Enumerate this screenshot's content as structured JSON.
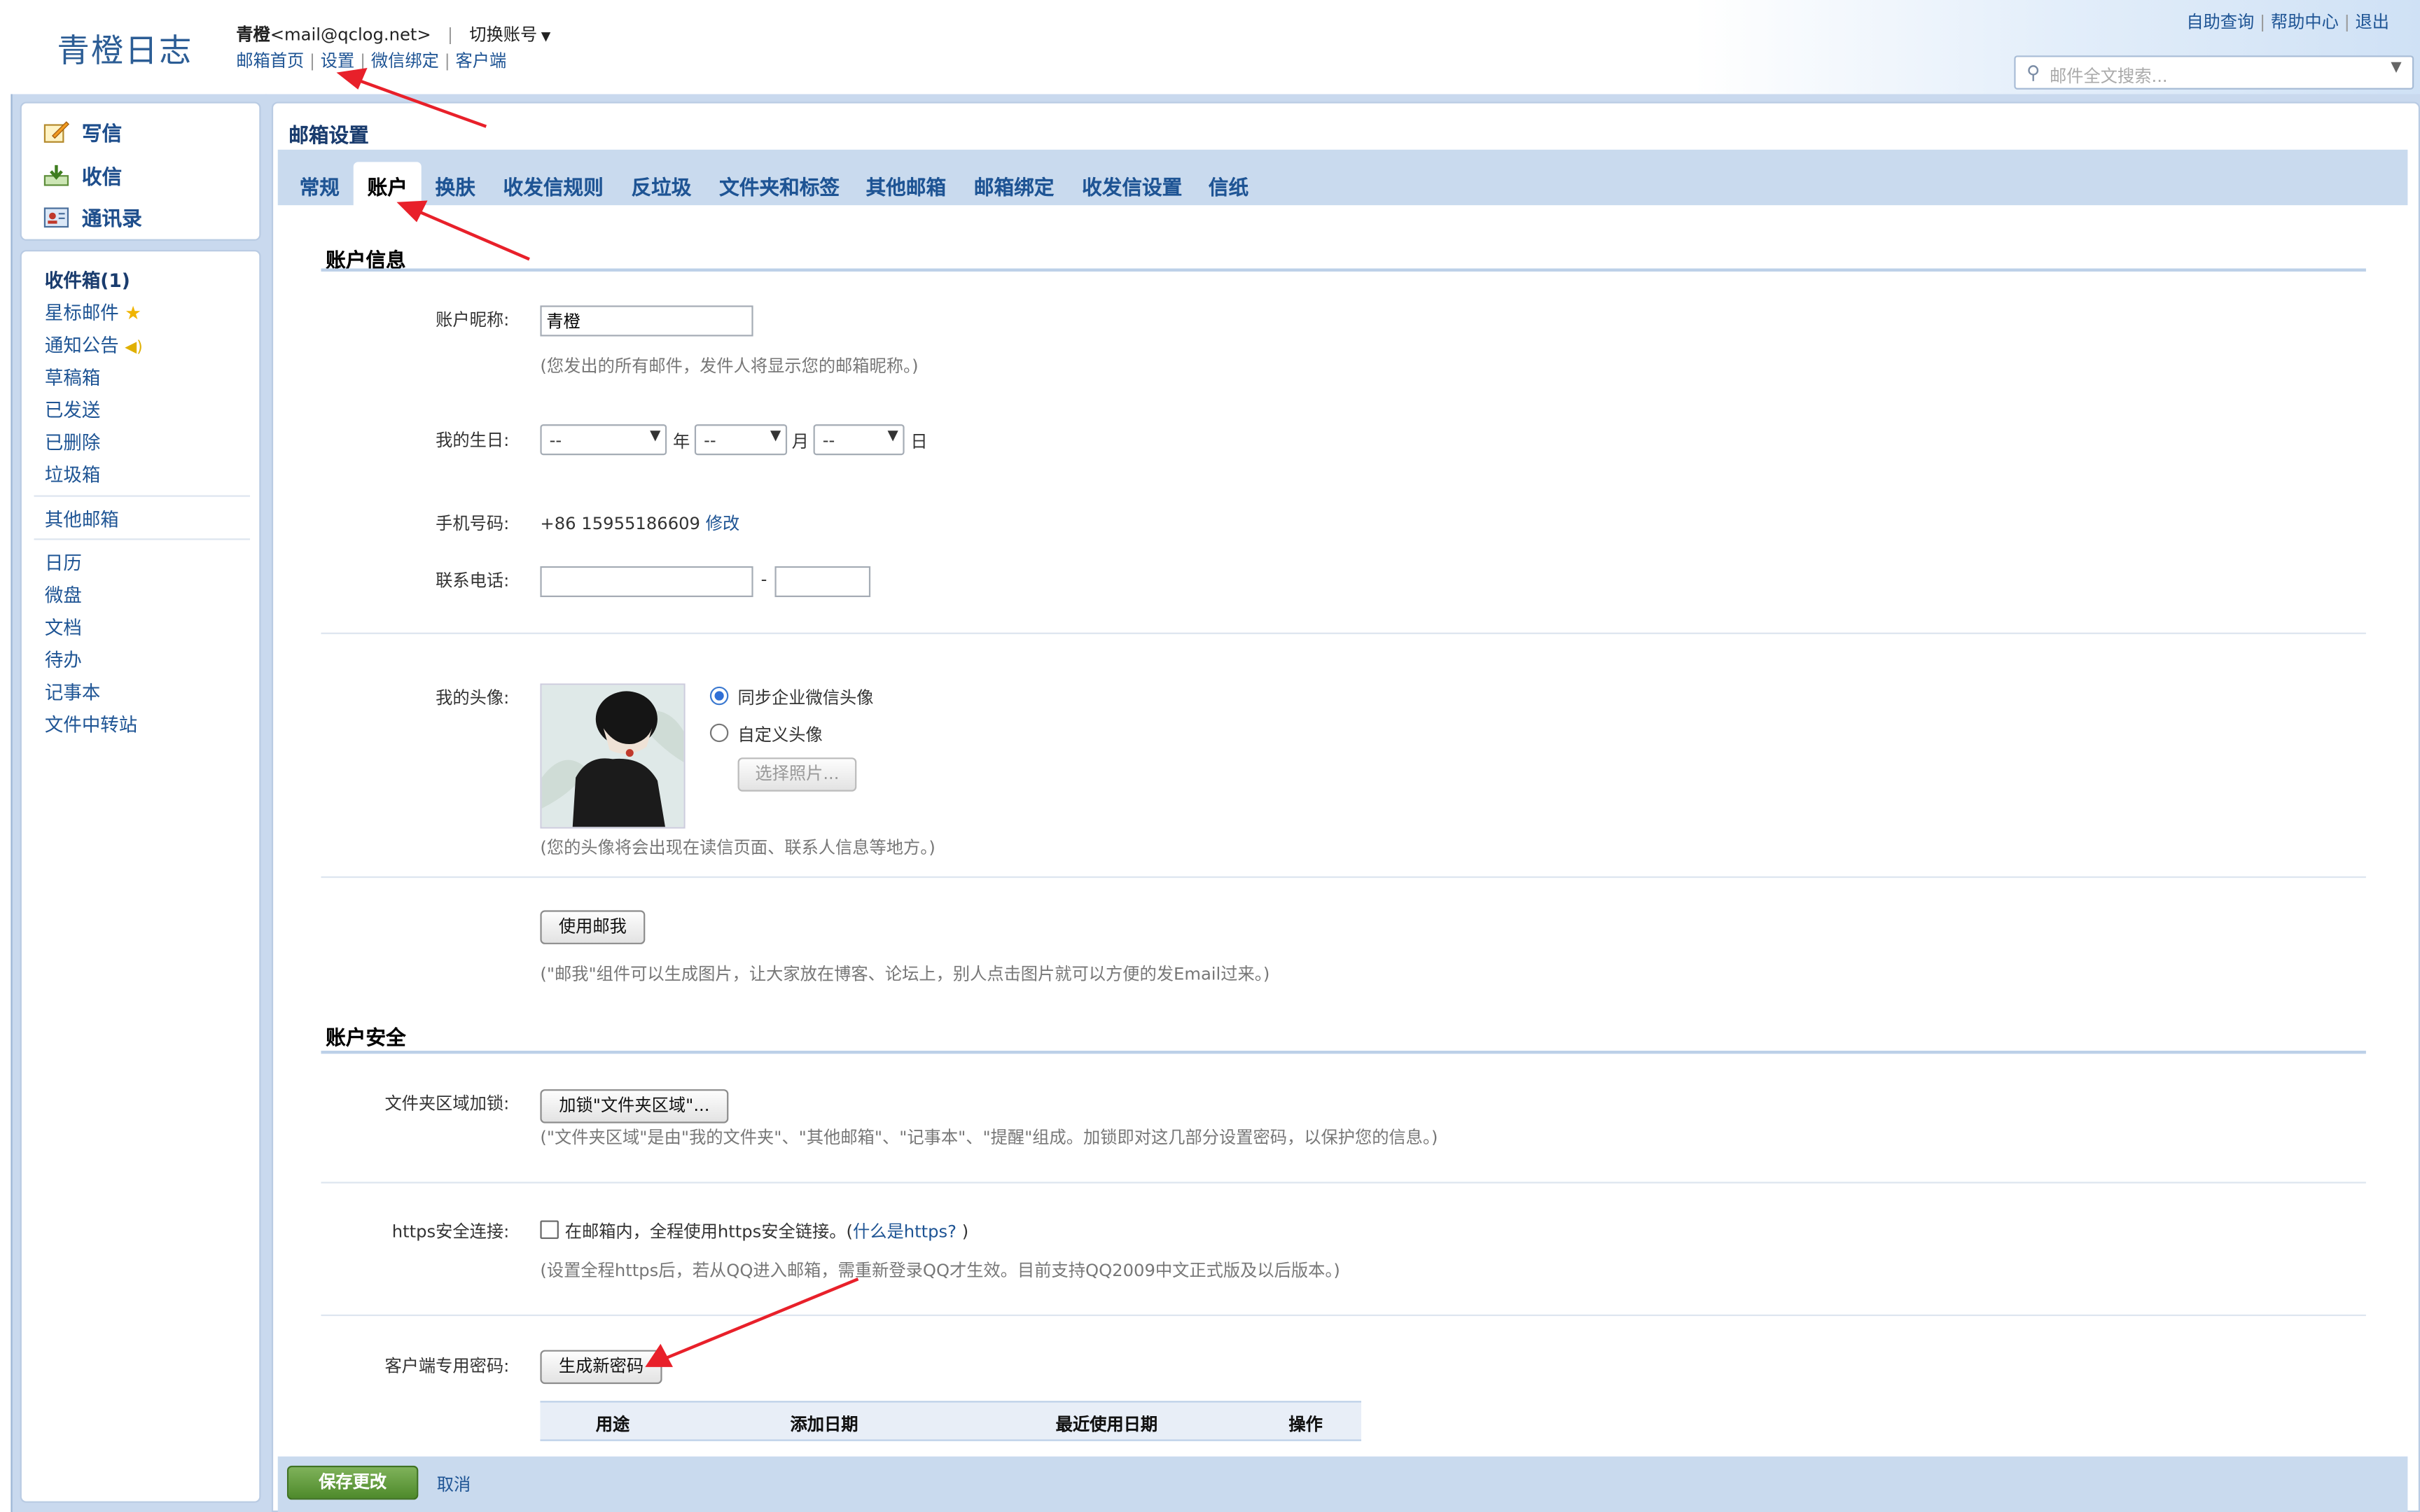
{
  "app": {
    "logo": "青橙日志"
  },
  "header": {
    "user_name": "青橙",
    "user_email": "<mail@qclog.net>",
    "separator": "|",
    "switch_account": "切换账号",
    "nav": [
      "邮箱首页",
      "设置",
      "微信绑定",
      "客户端"
    ],
    "top_links": [
      "自助查询",
      "帮助中心",
      "退出"
    ],
    "search_placeholder": "邮件全文搜索..."
  },
  "sidebar": {
    "tools": [
      {
        "label": "写信",
        "icon": "compose-icon"
      },
      {
        "label": "收信",
        "icon": "inbox-download-icon"
      },
      {
        "label": "通讯录",
        "icon": "contacts-icon"
      }
    ],
    "folders": [
      "收件箱(1)",
      "星标邮件",
      "通知公告",
      "草稿箱",
      "已发送",
      "已删除",
      "垃圾箱"
    ],
    "other_mail": "其他邮箱",
    "apps": [
      "日历",
      "微盘",
      "文档",
      "待办",
      "记事本",
      "文件中转站"
    ]
  },
  "main": {
    "title": "邮箱设置",
    "tabs": [
      "常规",
      "账户",
      "换肤",
      "收发信规则",
      "反垃圾",
      "文件夹和标签",
      "其他邮箱",
      "邮箱绑定",
      "收发信设置",
      "信纸"
    ],
    "active_tab": "账户",
    "account_info": {
      "section_title": "账户信息",
      "nickname_label": "账户昵称:",
      "nickname_value": "青橙",
      "nickname_hint": "(您发出的所有邮件，发件人将显示您的邮箱昵称。)",
      "birthday_label": "我的生日:",
      "birthday_year": "--",
      "birthday_month": "--",
      "birthday_day": "--",
      "unit_year": "年",
      "unit_month": "月",
      "unit_day": "日",
      "phone_label": "手机号码:",
      "phone_value": "+86 15955186609",
      "phone_edit": "修改",
      "contact_label": "联系电话:",
      "contact_dash": "-",
      "avatar_label": "我的头像:",
      "avatar_opt1": "同步企业微信头像",
      "avatar_opt2": "自定义头像",
      "choose_photo": "选择照片...",
      "avatar_hint": "(您的头像将会出现在读信页面、联系人信息等地方。)",
      "mailme_button": "使用邮我",
      "mailme_hint": "(\"邮我\"组件可以生成图片，让大家放在博客、论坛上，别人点击图片就可以方便的发Email过来。)"
    },
    "account_security": {
      "section_title": "账户安全",
      "folder_lock_label": "文件夹区域加锁:",
      "folder_lock_button": "加锁\"文件夹区域\"...",
      "folder_lock_hint": "(\"文件夹区域\"是由\"我的文件夹\"、\"其他邮箱\"、\"记事本\"、\"提醒\"组成。加锁即对这几部分设置密码，以保护您的信息。)",
      "https_label": "https安全连接:",
      "https_text": "在邮箱内，全程使用https安全链接。(",
      "https_link": "什么是https?",
      "https_close": ")",
      "https_hint": "(设置全程https后，若从QQ进入邮箱，需重新登录QQ才生效。目前支持QQ2009中文正式版及以后版本。)",
      "client_pw_label": "客户端专用密码:",
      "gen_pw_button": "生成新密码",
      "table_headers": [
        "用途",
        "添加日期",
        "最近使用日期",
        "操作"
      ]
    },
    "footer": {
      "save": "保存更改",
      "cancel": "取消"
    }
  },
  "colors": {
    "accent": "#1e5494",
    "frame": "#c9d9ee",
    "save": "#5a9632",
    "annotation_arrow": "#e8202a"
  }
}
